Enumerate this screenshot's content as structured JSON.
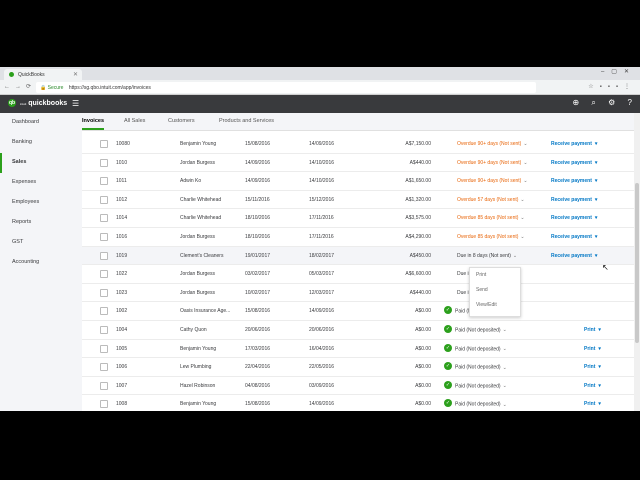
{
  "browser": {
    "tab_title": "QuickBooks",
    "secure_label": "Secure",
    "url": "https://sg.qbo.intuit.com/app/invoices"
  },
  "app": {
    "logo_text": "quickbooks",
    "logo_prefix": "intuit"
  },
  "sidebar": {
    "items": [
      {
        "label": "Dashboard"
      },
      {
        "label": "Banking"
      },
      {
        "label": "Sales"
      },
      {
        "label": "Expenses"
      },
      {
        "label": "Employees"
      },
      {
        "label": "Reports"
      },
      {
        "label": "GST"
      },
      {
        "label": "Accounting"
      }
    ],
    "active": "Sales"
  },
  "subtabs": [
    "Invoices",
    "All Sales",
    "Customers",
    "Products and Services"
  ],
  "table": {
    "rows": [
      {
        "no": "10080",
        "customer": "Benjamin Young",
        "date": "15/08/2016",
        "due": "14/09/2016",
        "amount": "A$7,150.00",
        "status": "Overdue 90+ days (Not sent)",
        "status_type": "overdue",
        "action": "Receive payment"
      },
      {
        "no": "1010",
        "customer": "Jordan Burgess",
        "date": "14/09/2016",
        "due": "14/10/2016",
        "amount": "A$440.00",
        "status": "Overdue 90+ days (Not sent)",
        "status_type": "overdue",
        "action": "Receive payment"
      },
      {
        "no": "1011",
        "customer": "Adwin Ko",
        "date": "14/09/2016",
        "due": "14/10/2016",
        "amount": "A$1,650.00",
        "status": "Overdue 90+ days (Not sent)",
        "status_type": "overdue",
        "action": "Receive payment"
      },
      {
        "no": "1012",
        "customer": "Charlie Whitehead",
        "date": "15/11/2016",
        "due": "15/12/2016",
        "amount": "A$1,320.00",
        "status": "Overdue 57 days (Not sent)",
        "status_type": "overdue",
        "action": "Receive payment"
      },
      {
        "no": "1014",
        "customer": "Charlie Whitehead",
        "date": "18/10/2016",
        "due": "17/11/2016",
        "amount": "A$3,575.00",
        "status": "Overdue 85 days (Not sent)",
        "status_type": "overdue",
        "action": "Receive payment"
      },
      {
        "no": "1016",
        "customer": "Jordan Burgess",
        "date": "18/10/2016",
        "due": "17/11/2016",
        "amount": "A$4,290.00",
        "status": "Overdue 85 days (Not sent)",
        "status_type": "overdue",
        "action": "Receive payment"
      },
      {
        "no": "1019",
        "customer": "Clement's Cleaners",
        "date": "19/01/2017",
        "due": "18/02/2017",
        "amount": "A$450.00",
        "status": "Due in 8 days (Not sent)",
        "status_type": "due",
        "action": "Receive payment"
      },
      {
        "no": "1022",
        "customer": "Jordan Burgess",
        "date": "03/02/2017",
        "due": "05/03/2017",
        "amount": "A$6,600.00",
        "status": "Due in 23 days (Not sent)",
        "status_type": "due",
        "action": ""
      },
      {
        "no": "1023",
        "customer": "Jordan Burgess",
        "date": "10/02/2017",
        "due": "12/03/2017",
        "amount": "A$440.00",
        "status": "Due in 30 days (Not sent)",
        "status_type": "due",
        "action": ""
      },
      {
        "no": "1002",
        "customer": "Oasis Insurance Age...",
        "date": "15/08/2016",
        "due": "14/09/2016",
        "amount": "A$0.00",
        "status": "Paid (Not deposited)",
        "status_type": "paid",
        "action": ""
      },
      {
        "no": "1004",
        "customer": "Cathy Quon",
        "date": "20/06/2016",
        "due": "20/06/2016",
        "amount": "A$0.00",
        "status": "Paid (Not deposited)",
        "status_type": "paid",
        "action": "Print"
      },
      {
        "no": "1005",
        "customer": "Benjamin Young",
        "date": "17/03/2016",
        "due": "16/04/2016",
        "amount": "A$0.00",
        "status": "Paid (Not deposited)",
        "status_type": "paid",
        "action": "Print"
      },
      {
        "no": "1006",
        "customer": "Lew Plumbing",
        "date": "22/04/2016",
        "due": "22/05/2016",
        "amount": "A$0.00",
        "status": "Paid (Not deposited)",
        "status_type": "paid",
        "action": "Print"
      },
      {
        "no": "1007",
        "customer": "Hazel Robinson",
        "date": "04/08/2016",
        "due": "03/09/2016",
        "amount": "A$0.00",
        "status": "Paid (Not deposited)",
        "status_type": "paid",
        "action": "Print"
      },
      {
        "no": "1008",
        "customer": "Benjamin Young",
        "date": "15/08/2016",
        "due": "14/09/2016",
        "amount": "A$0.00",
        "status": "Paid (Not deposited)",
        "status_type": "paid",
        "action": "Print"
      }
    ]
  },
  "action_menu": {
    "items": [
      "Print",
      "Send",
      "View/Edit"
    ]
  },
  "colors": {
    "brand_green": "#2ca01c",
    "overdue_orange": "#e8650a",
    "link_blue": "#0077c5",
    "header_dark": "#393a3d"
  }
}
